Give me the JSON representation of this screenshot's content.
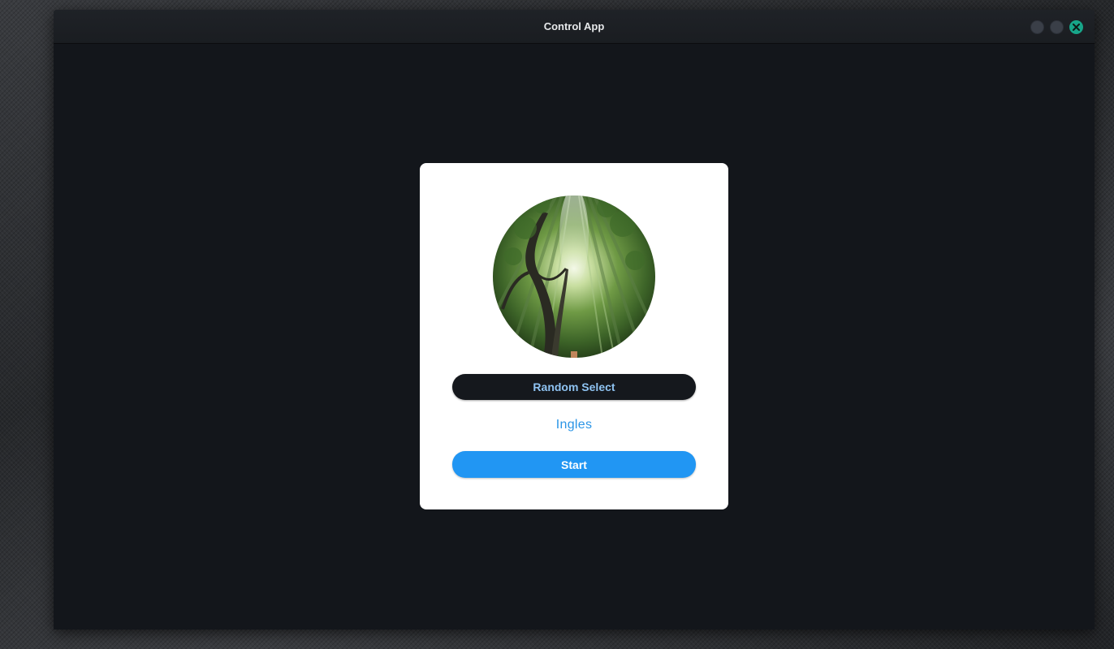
{
  "window": {
    "title": "Control App",
    "controls": {
      "minimize_icon": "circle-icon",
      "maximize_icon": "circle-icon",
      "close_icon": "close-icon"
    }
  },
  "card": {
    "image": "bamboo-forest-photo",
    "random_button_label": "Random Select",
    "selected_value": "Ingles",
    "start_button_label": "Start"
  },
  "colors": {
    "window_bg": "#13161b",
    "accent_blue": "#2196f3",
    "dark_button": "#15181d",
    "close_green": "#17a589"
  }
}
